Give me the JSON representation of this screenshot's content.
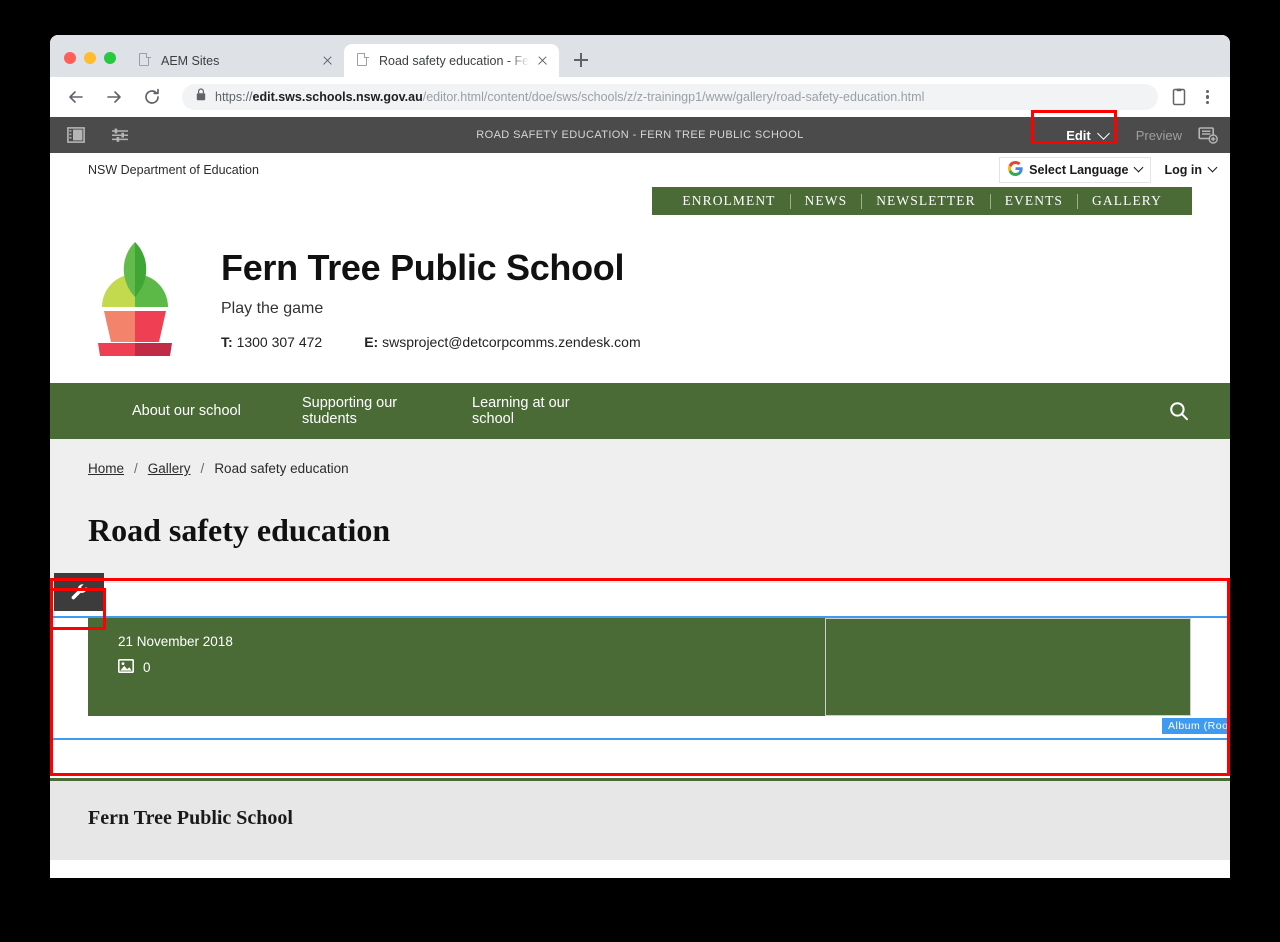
{
  "browser": {
    "tabs": [
      {
        "title": "AEM Sites",
        "active": false
      },
      {
        "title": "Road safety education - Fern T",
        "active": true
      }
    ],
    "new_tab_label": "+",
    "url": {
      "scheme": "https://",
      "domain": "edit.sws.schools.nsw.gov.au",
      "path": "/editor.html/content/doe/sws/schools/z/z-trainingp1/www/gallery/road-safety-education.html"
    }
  },
  "aem_toolbar": {
    "page_title": "ROAD SAFETY EDUCATION - FERN TREE PUBLIC SCHOOL",
    "edit_label": "Edit",
    "preview_label": "Preview",
    "highlight_color": "#ff0000"
  },
  "utility_bar": {
    "department": "NSW Department of Education",
    "language_label": "Select Language",
    "google_g": "G",
    "login_label": "Log in"
  },
  "quicklinks": [
    "ENROLMENT",
    "NEWS",
    "NEWSLETTER",
    "EVENTS",
    "GALLERY"
  ],
  "brand": {
    "school_name": "Fern Tree Public School",
    "tagline": "Play the game",
    "phone_label": "T:",
    "phone": "1300 307 472",
    "email_label": "E:",
    "email": "swsproject@detcorpcomms.zendesk.com",
    "green": "#4a6b36"
  },
  "main_nav": [
    "About our school",
    "Supporting our students",
    "Learning at our school"
  ],
  "breadcrumbs": [
    {
      "label": "Home",
      "link": true
    },
    {
      "label": "Gallery",
      "link": true
    },
    {
      "label": "Road safety education",
      "link": false
    }
  ],
  "page": {
    "title": "Road safety education"
  },
  "album": {
    "date": "21 November 2018",
    "image_count": "0",
    "component_badge": "Album (Root",
    "selection_color": "#3f9bf1"
  },
  "footer": {
    "title": "Fern Tree Public School"
  }
}
